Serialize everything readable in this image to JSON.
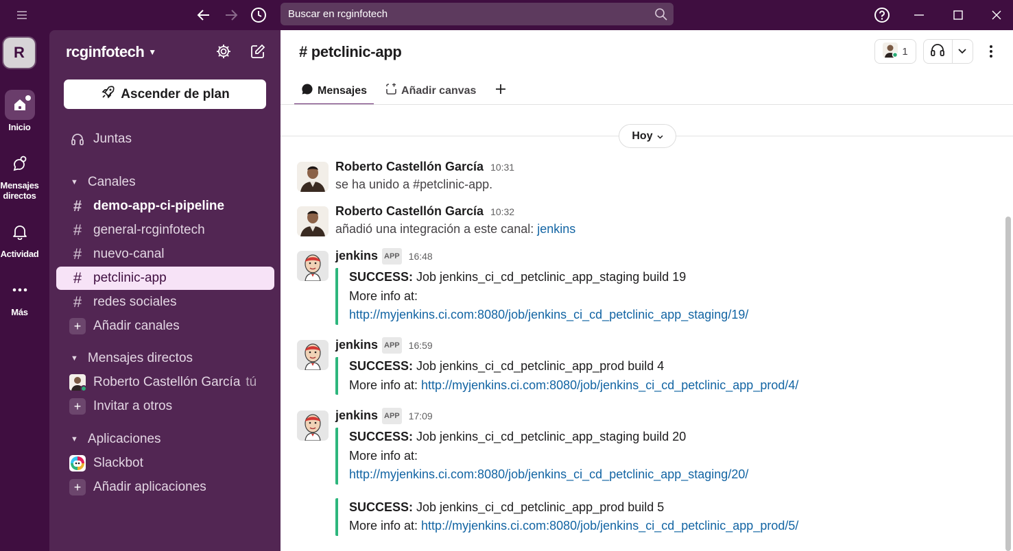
{
  "titlebar": {
    "search_placeholder": "Buscar en rcginfotech"
  },
  "rail": {
    "workspace_initial": "R",
    "items": [
      {
        "label": "Inicio"
      },
      {
        "label": "Mensajes directos"
      },
      {
        "label": "Actividad"
      },
      {
        "label": "Más"
      }
    ]
  },
  "sidebar": {
    "workspace_name": "rcginfotech",
    "upgrade_label": "Ascender de plan",
    "huddles_label": "Juntas",
    "channels_section": "Canales",
    "channels": [
      {
        "name": "demo-app-ci-pipeline",
        "unread": true
      },
      {
        "name": "general-rcginfotech"
      },
      {
        "name": "nuevo-canal"
      },
      {
        "name": "petclinic-app",
        "active": true
      },
      {
        "name": "redes sociales"
      }
    ],
    "add_channels": "Añadir canales",
    "dm_section": "Mensajes directos",
    "dm_user": "Roberto Castellón García",
    "dm_you": "tú",
    "invite": "Invitar a otros",
    "apps_section": "Aplicaciones",
    "slackbot": "Slackbot",
    "add_apps": "Añadir aplicaciones"
  },
  "channel": {
    "title": "# petclinic-app",
    "member_count": "1",
    "tabs": [
      "Mensajes",
      "Añadir canvas"
    ],
    "day_divider": "Hoy"
  },
  "messages": [
    {
      "author": "Roberto Castellón García",
      "time": "10:31",
      "text": "se ha unido a #petclinic-app."
    },
    {
      "author": "Roberto Castellón García",
      "time": "10:32",
      "text": "añadió una integración a este canal: ",
      "link": "jenkins"
    },
    {
      "author": "jenkins",
      "badge": "APP",
      "time": "16:48",
      "attachments": [
        {
          "status": "SUCCESS:",
          "job": " Job jenkins_ci_cd_petclinic_app_staging build 19",
          "more": "More info at:",
          "url": "http://myjenkins.ci.com:8080/job/jenkins_ci_cd_petclinic_app_staging/19/"
        }
      ]
    },
    {
      "author": "jenkins",
      "badge": "APP",
      "time": "16:59",
      "attachments": [
        {
          "status": "SUCCESS:",
          "job": " Job jenkins_ci_cd_petclinic_app_prod build 4",
          "more": "More info at: ",
          "url": "http://myjenkins.ci.com:8080/job/jenkins_ci_cd_petclinic_app_prod/4/"
        }
      ]
    },
    {
      "author": "jenkins",
      "badge": "APP",
      "time": "17:09",
      "attachments": [
        {
          "status": "SUCCESS:",
          "job": " Job jenkins_ci_cd_petclinic_app_staging build 20",
          "more": "More info at:",
          "url": "http://myjenkins.ci.com:8080/job/jenkins_ci_cd_petclinic_app_staging/20/"
        },
        {
          "status": "SUCCESS:",
          "job": " Job jenkins_ci_cd_petclinic_app_prod build 5",
          "more": "More info at: ",
          "url": "http://myjenkins.ci.com:8080/job/jenkins_ci_cd_petclinic_app_prod/5/"
        }
      ]
    }
  ],
  "colors": {
    "aubergine": "#3f0e40",
    "sidebar": "#522653",
    "success_bar": "#2eb67d",
    "link": "#1264a3"
  }
}
